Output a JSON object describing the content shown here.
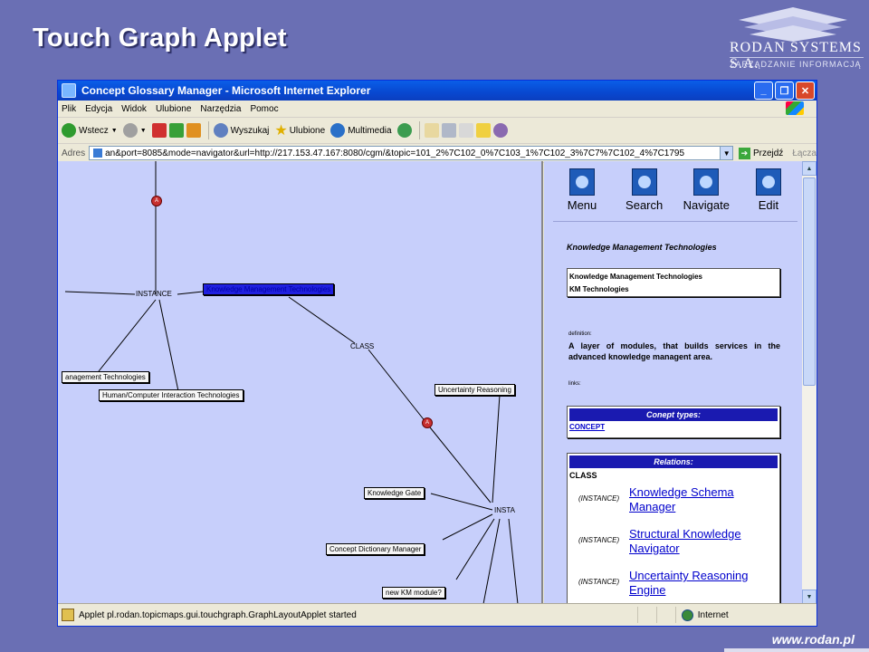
{
  "slide": {
    "title": "Touch Graph Applet",
    "logo_name": "RODAN SYSTEMS S.A.",
    "logo_sub": "ZARZĄDZANIE INFORMACJĄ",
    "footer_url": "www.rodan.pl"
  },
  "window": {
    "title": "Concept Glossary Manager - Microsoft Internet Explorer",
    "menu": [
      "Plik",
      "Edycja",
      "Widok",
      "Ulubione",
      "Narzędzia",
      "Pomoc"
    ],
    "toolbar": {
      "back": "Wstecz",
      "search": "Wyszukaj",
      "favorites": "Ulubione",
      "media": "Multimedia"
    },
    "address": {
      "label": "Adres",
      "url": "an&port=8085&mode=navigator&url=http://217.153.47.167:8080/cgm/&topic=101_2%7C102_0%7C103_1%7C102_3%7C7%7C102_4%7C1795",
      "go": "Przejdź",
      "links": "Łącza"
    },
    "status": {
      "text": "Applet pl.rodan.topicmaps.gui.touchgraph.GraphLayoutApplet started",
      "zone": "Internet"
    }
  },
  "graph": {
    "badge_letter": "A",
    "labels": {
      "instance_left": "INSTANCE",
      "class": "CLASS",
      "instance_right": "INSTA"
    },
    "nodes": {
      "selected": "Knowledge Management Technologies",
      "mgmt": "anagement Technologies",
      "hci": "Human/Computer Interaction Technologies",
      "uncertainty": "Uncertainty Reasoning",
      "gate": "Knowledge Gate",
      "dictionary": "Concept Dictionary Manager",
      "newkm": "new KM module?"
    }
  },
  "panel": {
    "nav": [
      {
        "label": "Menu"
      },
      {
        "label": "Search"
      },
      {
        "label": "Navigate"
      },
      {
        "label": "Edit"
      }
    ],
    "topic_title": "Knowledge Management Technologies",
    "names": [
      "Knowledge Management Technologies",
      "KM Technologies"
    ],
    "definition_label": "definition:",
    "definition": "A layer of modules, that builds services in the advanced knowledge managent area.",
    "links_label": "links:",
    "concept_types_header": "Conept types:",
    "concept_type": "CONCEPT",
    "relations_header": "Relations:",
    "relations_class": "CLASS",
    "relations": [
      {
        "type": "(INSTANCE)",
        "target": "Knowledge Schema Manager"
      },
      {
        "type": "(INSTANCE)",
        "target": "Structural Knowledge Navigator"
      },
      {
        "type": "(INSTANCE)",
        "target": "Uncertainty Reasoning Engine"
      }
    ]
  }
}
